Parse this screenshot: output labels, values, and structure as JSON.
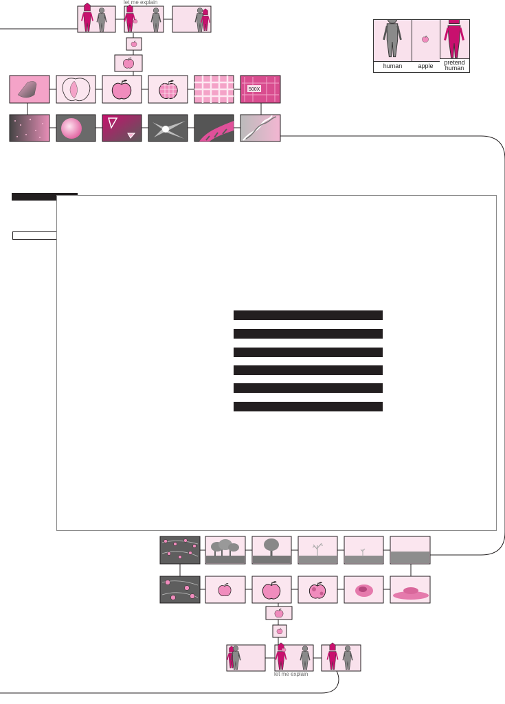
{
  "captions": {
    "top_explain": "let me explain",
    "bottom_explain": "let me explain",
    "microscope_label": "500X"
  },
  "legend": {
    "human": "human",
    "apple": "apple",
    "pretend_human": "pretend human"
  },
  "colors": {
    "magenta": "#c8106e",
    "pink_light": "#f9e1ec",
    "pink_mid": "#f08cbd",
    "grey_figure": "#8a8a8a",
    "dark": "#231f20"
  },
  "panel": {
    "redacted_lines": 6
  }
}
